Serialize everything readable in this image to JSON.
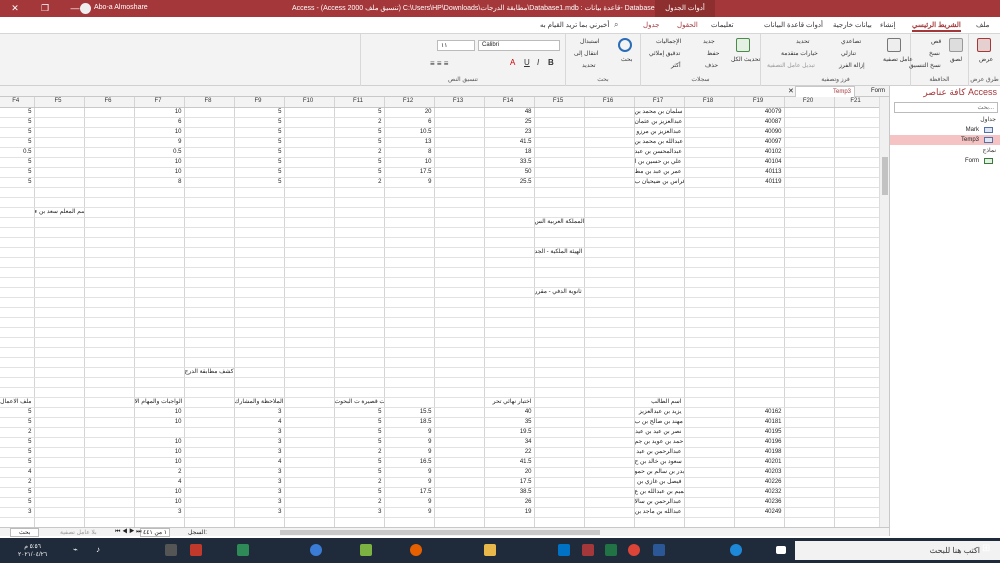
{
  "window": {
    "user": "Abo-a Almoshare",
    "title": "Access  -  (Access 2000 تنسيق ملف) C:\\Users\\HP\\Downloads\\مطابقة الدرجات\\Database1.mdb : قاعدة بيانات- Database1",
    "context_tab": "أدوات الجدول"
  },
  "menu": {
    "file": "ملف",
    "home": "الشريط الرئيسي",
    "create": "إنشاء",
    "external": "بيانات خارجية",
    "dbtools": "أدوات قاعدة البيانات",
    "help": "تعليمات",
    "fields": "الحقول",
    "table": "جدول",
    "tellme": "أخبرني بما تريد القيام به"
  },
  "ribbon": {
    "views": {
      "label": "طرق عرض",
      "view": "عرض"
    },
    "clipboard": {
      "label": "الحافظة",
      "paste": "لصق",
      "cut": "قص",
      "copy": "نسخ",
      "format_painter": "نسخ التنسيق"
    },
    "sort": {
      "label": "فرز وتصفية",
      "filter": "عامل تصفية",
      "asc": "تصاعدي",
      "desc": "تنازلي",
      "remove_sort": "إزالة الفرز",
      "selection": "تحديد",
      "advanced": "خيارات متقدمة",
      "toggle": "تبديل عامل التصفية"
    },
    "records": {
      "label": "سجلات",
      "refresh": "تحديث الكل",
      "new": "جديد",
      "save": "حفظ",
      "delete": "حذف",
      "totals": "الإجماليات",
      "spelling": "تدقيق إملائي",
      "more": "أكثر"
    },
    "find": {
      "label": "بحث",
      "find": "بحث",
      "replace": "استبدال",
      "goto": "انتقال إلى",
      "select": "تحديد"
    },
    "text": {
      "label": "تنسيق النص",
      "font": "Calibri",
      "size": "١١"
    }
  },
  "nav": {
    "title": "كافة عناصر Access",
    "search_placeholder": "بحث...",
    "tables_group": "جداول",
    "forms_group": "نماذج",
    "items": [
      {
        "label": "Mark"
      },
      {
        "label": "Temp3"
      },
      {
        "label": "Form"
      }
    ]
  },
  "tabs": [
    {
      "label": "Temp3"
    },
    {
      "label": "Form"
    }
  ],
  "columns": [
    "F4",
    "F5",
    "F6",
    "F7",
    "F8",
    "F9",
    "F10",
    "F11",
    "F12",
    "F13",
    "F14",
    "F15",
    "F16",
    "F17",
    "F18",
    "F19",
    "F20",
    "F21"
  ],
  "rows": [
    [
      "5",
      "",
      "",
      "10",
      "",
      "5",
      "",
      "5",
      "20",
      "",
      "48",
      "",
      "",
      "سلمان بن محمد بن",
      "",
      "40079",
      "",
      ""
    ],
    [
      "5",
      "",
      "",
      "6",
      "",
      "5",
      "",
      "2",
      "6",
      "",
      "25",
      "",
      "",
      "عبدالعزيز بن عثمان",
      "",
      "40087",
      "",
      ""
    ],
    [
      "5",
      "",
      "",
      "10",
      "",
      "5",
      "",
      "5",
      "10.5",
      "",
      "23",
      "",
      "",
      "عبدالعزيز بن مرزو",
      "",
      "40090",
      "",
      ""
    ],
    [
      "5",
      "",
      "",
      "9",
      "",
      "5",
      "",
      "5",
      "13",
      "",
      "41.5",
      "",
      "",
      "عبدالله بن محمد بن",
      "",
      "40097",
      "",
      ""
    ],
    [
      "0.5",
      "",
      "",
      "0.5",
      "",
      "5",
      "",
      "2",
      "8",
      "",
      "18",
      "",
      "",
      "عبدالمحسن بن عبد",
      "",
      "40102",
      "",
      ""
    ],
    [
      "5",
      "",
      "",
      "10",
      "",
      "5",
      "",
      "5",
      "10",
      "",
      "33.5",
      "",
      "",
      "علي بن حسين بن ا",
      "",
      "40104",
      "",
      ""
    ],
    [
      "5",
      "",
      "",
      "10",
      "",
      "5",
      "",
      "5",
      "17.5",
      "",
      "50",
      "",
      "",
      "عمر بن عبد بن مط",
      "",
      "40113",
      "",
      ""
    ],
    [
      "5",
      "",
      "",
      "8",
      "",
      "5",
      "",
      "2",
      "9",
      "",
      "25.5",
      "",
      "",
      "فراس بن ضيحيان ب",
      "",
      "40119",
      "",
      ""
    ],
    [
      "",
      "",
      "",
      "",
      "",
      "",
      "",
      "",
      "",
      "",
      "",
      "",
      "",
      "",
      "",
      "",
      "",
      ""
    ],
    [
      "",
      "",
      "",
      "",
      "",
      "",
      "",
      "",
      "",
      "",
      "",
      "",
      "",
      "",
      "",
      "",
      "",
      ""
    ],
    [
      "",
      "اسم المعلم سعد بن ء",
      "",
      "",
      "",
      "",
      "",
      "",
      "",
      "",
      "",
      "",
      "",
      "",
      "",
      "",
      "",
      ""
    ],
    [
      "",
      "",
      "",
      "",
      "",
      "",
      "",
      "",
      "",
      "",
      "",
      "المملكة العربية الس",
      "",
      "",
      "",
      "",
      "",
      ""
    ],
    [
      "",
      "",
      "",
      "",
      "",
      "",
      "",
      "",
      "",
      "",
      "",
      "",
      "",
      "",
      "",
      "",
      "",
      ""
    ],
    [
      "",
      "",
      "",
      "",
      "",
      "",
      "",
      "",
      "",
      "",
      "",
      "",
      "",
      "",
      "",
      "",
      "",
      ""
    ],
    [
      "",
      "",
      "",
      "",
      "",
      "",
      "",
      "",
      "",
      "",
      "",
      "الهيئة الملكية - الجد",
      "",
      "",
      "",
      "",
      "",
      ""
    ],
    [
      "",
      "",
      "",
      "",
      "",
      "",
      "",
      "",
      "",
      "",
      "",
      "",
      "",
      "",
      "",
      "",
      "",
      ""
    ],
    [
      "",
      "",
      "",
      "",
      "",
      "",
      "",
      "",
      "",
      "",
      "",
      "",
      "",
      "",
      "",
      "",
      "",
      ""
    ],
    [
      "",
      "",
      "",
      "",
      "",
      "",
      "",
      "",
      "",
      "",
      "",
      "",
      "",
      "",
      "",
      "",
      "",
      ""
    ],
    [
      "",
      "",
      "",
      "",
      "",
      "",
      "",
      "",
      "",
      "",
      "",
      "ثانوية الدفي - مقرر",
      "",
      "",
      "",
      "",
      "",
      ""
    ],
    [
      "",
      "",
      "",
      "",
      "",
      "",
      "",
      "",
      "",
      "",
      "",
      "",
      "",
      "",
      "",
      "",
      "",
      ""
    ],
    [
      "",
      "",
      "",
      "",
      "",
      "",
      "",
      "",
      "",
      "",
      "",
      "",
      "",
      "",
      "",
      "",
      "",
      ""
    ],
    [
      "",
      "",
      "",
      "",
      "",
      "",
      "",
      "",
      "",
      "",
      "",
      "",
      "",
      "",
      "",
      "",
      "",
      ""
    ],
    [
      "",
      "",
      "",
      "",
      "",
      "",
      "",
      "",
      "",
      "",
      "",
      "",
      "",
      "",
      "",
      "",
      "",
      ""
    ],
    [
      "",
      "",
      "",
      "",
      "",
      "",
      "",
      "",
      "",
      "",
      "",
      "",
      "",
      "",
      "",
      "",
      "",
      ""
    ],
    [
      "",
      "",
      "",
      "",
      "",
      "",
      "",
      "",
      "",
      "",
      "",
      "",
      "",
      "",
      "",
      "",
      "",
      ""
    ],
    [
      "",
      "",
      "",
      "",
      "",
      "",
      "",
      "",
      "",
      "",
      "",
      "",
      "",
      "",
      "",
      "",
      "",
      ""
    ],
    [
      "",
      "",
      "",
      "",
      "كشف مطابقة الدرج",
      "",
      "",
      "",
      "",
      "",
      "",
      "",
      "",
      "",
      "",
      "",
      "",
      ""
    ],
    [
      "",
      "",
      "",
      "",
      "",
      "",
      "",
      "",
      "",
      "",
      "",
      "",
      "",
      "",
      "",
      "",
      "",
      ""
    ],
    [
      "",
      "",
      "",
      "",
      "",
      "",
      "",
      "",
      "",
      "",
      "",
      "",
      "",
      "",
      "",
      "",
      "",
      ""
    ],
    [
      "ملف الاعمال",
      "",
      "",
      "الواجبات والمهام الا",
      "",
      "الملاحظة والمشارك",
      "",
      "اختبارات قصيرة ت البحوث",
      "",
      "",
      "اختبار نهائي تحر",
      "",
      "",
      "اسم الطالب",
      "",
      "",
      "",
      ""
    ],
    [
      "5",
      "",
      "",
      "10",
      "",
      "3",
      "",
      "5",
      "15.5",
      "",
      "40",
      "",
      "",
      "يزيد بن عبدالعزيز",
      "",
      "40162",
      "",
      ""
    ],
    [
      "5",
      "",
      "",
      "10",
      "",
      "4",
      "",
      "5",
      "18.5",
      "",
      "35",
      "",
      "",
      "مهند بن صالح بن ب",
      "",
      "40181",
      "",
      ""
    ],
    [
      "2",
      "",
      "",
      "",
      "",
      "3",
      "",
      "5",
      "9",
      "",
      "19.5",
      "",
      "",
      "نصر بن عيد بن عيد",
      "",
      "40195",
      "",
      ""
    ],
    [
      "5",
      "",
      "",
      "10",
      "",
      "3",
      "",
      "5",
      "9",
      "",
      "34",
      "",
      "",
      "حمد بن عويد بن جم",
      "",
      "40196",
      "",
      ""
    ],
    [
      "5",
      "",
      "",
      "10",
      "",
      "3",
      "",
      "2",
      "9",
      "",
      "22",
      "",
      "",
      "عبدالرحمن بن عيد",
      "",
      "40198",
      "",
      ""
    ],
    [
      "5",
      "",
      "",
      "10",
      "",
      "4",
      "",
      "5",
      "16.5",
      "",
      "41.5",
      "",
      "",
      "سعود بن خالد بن ح",
      "",
      "40201",
      "",
      ""
    ],
    [
      "4",
      "",
      "",
      "2",
      "",
      "3",
      "",
      "5",
      "9",
      "",
      "20",
      "",
      "",
      "بدر بن سالم بن حمو",
      "",
      "40203",
      "",
      ""
    ],
    [
      "2",
      "",
      "",
      "4",
      "",
      "3",
      "",
      "2",
      "9",
      "",
      "17.5",
      "",
      "",
      "فيصل بن غازي بن",
      "",
      "40226",
      "",
      ""
    ],
    [
      "5",
      "",
      "",
      "10",
      "",
      "3",
      "",
      "5",
      "17.5",
      "",
      "38.5",
      "",
      "",
      "تميم بن عبدالله بن ع",
      "",
      "40232",
      "",
      ""
    ],
    [
      "5",
      "",
      "",
      "10",
      "",
      "3",
      "",
      "2",
      "9",
      "",
      "26",
      "",
      "",
      "عبدالرحمن بن سالا",
      "",
      "40236",
      "",
      ""
    ],
    [
      "3",
      "",
      "",
      "3",
      "",
      "3",
      "",
      "3",
      "9",
      "",
      "19",
      "",
      "",
      "عبدالله بن ماجد بن",
      "",
      "40249",
      "",
      ""
    ],
    [
      "",
      "",
      "",
      "",
      "",
      "",
      "",
      "",
      "",
      "",
      "",
      "",
      "",
      "",
      "",
      "",
      "",
      ""
    ]
  ],
  "record_nav": {
    "label": "السجل:",
    "current": "١ من ٤٤١",
    "no_filter": "بلا عامل تصفية",
    "search": "بحث"
  },
  "taskbar": {
    "search": "اكتب هنا للبحث",
    "time": "٥:٥٦ م",
    "date": "٢٠٢١/٠٤/٢٦"
  }
}
